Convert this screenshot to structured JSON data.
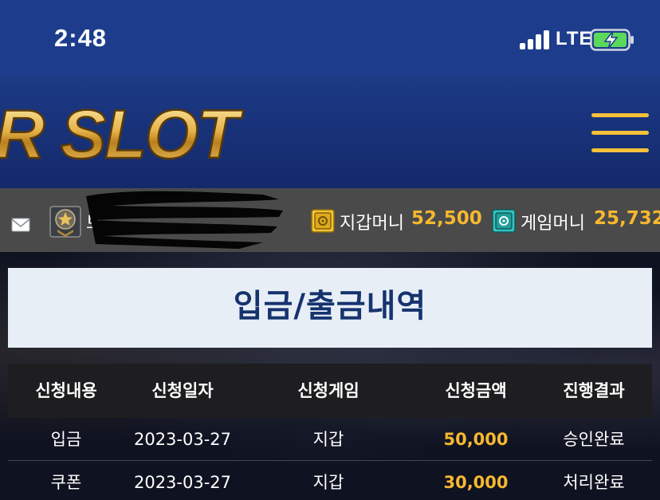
{
  "status_bar": {
    "time": "2:48",
    "network": "LTE",
    "icons": [
      "signal-icon",
      "battery-charging-icon"
    ]
  },
  "header": {
    "logo_text": "R SLOT",
    "menu_icon": "hamburger-menu-icon",
    "accent_color": "#f5c13a"
  },
  "user_bar": {
    "icons": [
      "mail-icon",
      "rank-badge-icon",
      "wallet-icon",
      "game-safe-icon"
    ],
    "user_name_visible": "브",
    "wallet_label": "지갑머니",
    "wallet_value": "52,500",
    "game_label": "게임머니",
    "game_value": "25,732",
    "value_color": "#f6b830"
  },
  "page": {
    "title": "입금/출금내역"
  },
  "table": {
    "headers": [
      "신청내용",
      "신청일자",
      "신청게임",
      "신청금액",
      "진행결과"
    ],
    "rows": [
      {
        "type": "입금",
        "date": "2023-03-27",
        "game": "지갑",
        "amount": "50,000",
        "status": "승인완료"
      },
      {
        "type": "쿠폰",
        "date": "2023-03-27",
        "game": "지갑",
        "amount": "30,000",
        "status": "처리완료"
      }
    ]
  }
}
